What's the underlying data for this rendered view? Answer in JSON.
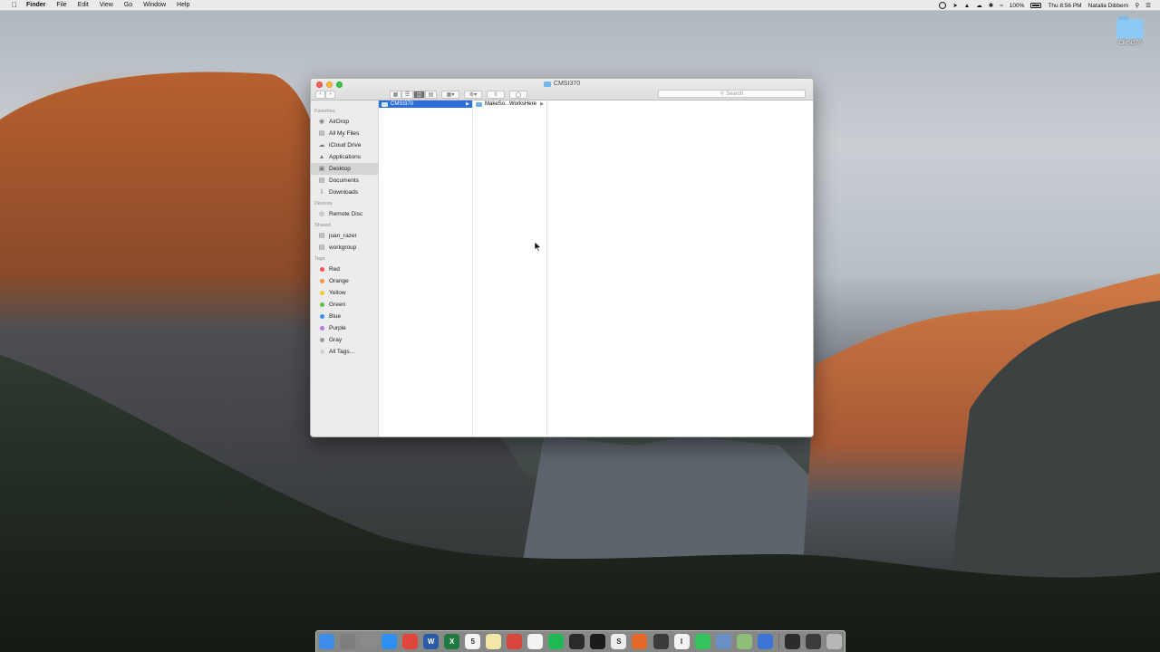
{
  "menubar": {
    "app_name": "Finder",
    "items": [
      "File",
      "Edit",
      "View",
      "Go",
      "Window",
      "Help"
    ],
    "battery": "100%",
    "clock": "Thu 8:56 PM",
    "user": "Natalia Dibbern"
  },
  "desktop": {
    "folder_label": "CMSI370"
  },
  "window": {
    "title": "CMSI370",
    "search_placeholder": "Search",
    "sidebar": {
      "favorites_header": "Favorites",
      "favorites": [
        {
          "label": "AirDrop",
          "icon": "airdrop-icon"
        },
        {
          "label": "All My Files",
          "icon": "all-files-icon"
        },
        {
          "label": "iCloud Drive",
          "icon": "cloud-icon"
        },
        {
          "label": "Applications",
          "icon": "applications-icon"
        },
        {
          "label": "Desktop",
          "icon": "desktop-icon",
          "selected": true
        },
        {
          "label": "Documents",
          "icon": "documents-icon"
        },
        {
          "label": "Downloads",
          "icon": "downloads-icon"
        }
      ],
      "devices_header": "Devices",
      "devices": [
        {
          "label": "Remote Disc",
          "icon": "disc-icon"
        }
      ],
      "shared_header": "Shared",
      "shared": [
        {
          "label": "juan_razer",
          "icon": "computer-icon"
        },
        {
          "label": "workgroup",
          "icon": "network-icon"
        }
      ],
      "tags_header": "Tags",
      "tags": [
        {
          "label": "Red",
          "color": "#fc4f4f"
        },
        {
          "label": "Orange",
          "color": "#f7963a"
        },
        {
          "label": "Yellow",
          "color": "#f5cc2f"
        },
        {
          "label": "Green",
          "color": "#5fc04a"
        },
        {
          "label": "Blue",
          "color": "#3c8ef0"
        },
        {
          "label": "Purple",
          "color": "#b77fdc"
        },
        {
          "label": "Gray",
          "color": "#9a9a9a"
        },
        {
          "label": "All Tags...",
          "color": "#d0d0d0"
        }
      ]
    },
    "columns": {
      "col1": [
        {
          "label": "CMSI370",
          "selected": true
        }
      ],
      "col2": [
        {
          "label": "MakeSo...WorksHere",
          "selected": false
        }
      ]
    }
  },
  "dock": {
    "apps": [
      {
        "name": "finder-icon",
        "color": "#3d8ee8",
        "glyph": ""
      },
      {
        "name": "system-preferences-icon",
        "color": "#7d7d7d",
        "glyph": ""
      },
      {
        "name": "launchpad-icon",
        "color": "#8a8a8a",
        "glyph": ""
      },
      {
        "name": "safari-icon",
        "color": "#2f8ff0",
        "glyph": ""
      },
      {
        "name": "chrome-icon",
        "color": "#e0473a",
        "glyph": ""
      },
      {
        "name": "word-icon",
        "color": "#2b5aa8",
        "glyph": "W"
      },
      {
        "name": "excel-icon",
        "color": "#1f7a42",
        "glyph": "X"
      },
      {
        "name": "calendar-icon",
        "color": "#f4f4f4",
        "glyph": "5"
      },
      {
        "name": "notes-icon",
        "color": "#f2e7a8",
        "glyph": ""
      },
      {
        "name": "todoist-icon",
        "color": "#d8463c",
        "glyph": ""
      },
      {
        "name": "photos-icon",
        "color": "#f3f3f3",
        "glyph": ""
      },
      {
        "name": "spotify-icon",
        "color": "#1fb954",
        "glyph": ""
      },
      {
        "name": "terminal-icon",
        "color": "#2a2a2a",
        "glyph": ""
      },
      {
        "name": "intellij-icon",
        "color": "#1b1b1b",
        "glyph": ""
      },
      {
        "name": "sublime-icon",
        "color": "#ededed",
        "glyph": "S"
      },
      {
        "name": "matlab-icon",
        "color": "#e4692b",
        "glyph": ""
      },
      {
        "name": "console-icon",
        "color": "#3a3a3a",
        "glyph": ""
      },
      {
        "name": "textedit-icon",
        "color": "#f2f2f2",
        "glyph": "I"
      },
      {
        "name": "whatsapp-icon",
        "color": "#34c25a",
        "glyph": ""
      },
      {
        "name": "preview-icon",
        "color": "#6a8fc7",
        "glyph": ""
      },
      {
        "name": "app-icon",
        "color": "#8fbf76",
        "glyph": ""
      },
      {
        "name": "itunes-icon",
        "color": "#3d74d8",
        "glyph": ""
      },
      {
        "name": "gear-app-icon",
        "color": "#2c2c2c",
        "glyph": ""
      },
      {
        "name": "display-icon",
        "color": "#3c3c3c",
        "glyph": ""
      },
      {
        "name": "trash-icon",
        "color": "#b8b8b8",
        "glyph": ""
      }
    ]
  }
}
